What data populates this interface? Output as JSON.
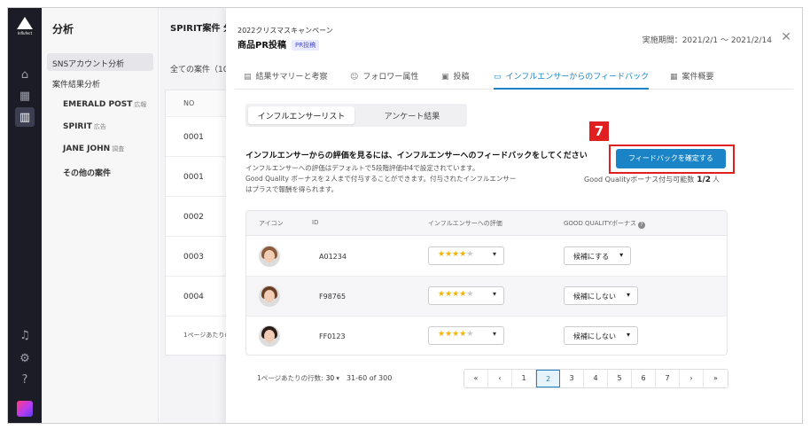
{
  "rail": {
    "logo_text": "Influfect",
    "icons": [
      "home-icon",
      "calendar-icon",
      "chart-icon",
      "bell-icon",
      "gear-icon",
      "help-icon"
    ]
  },
  "sidebar": {
    "title": "分析",
    "items": [
      {
        "label": "SNSアカウント分析",
        "tag": ""
      },
      {
        "label": "案件結果分析",
        "tag": ""
      },
      {
        "label": "EMERALD POST",
        "tag": "広報"
      },
      {
        "label": "SPIRIT",
        "tag": "広告"
      },
      {
        "label": "JANE JOHN",
        "tag": "調査"
      },
      {
        "label": "その他の案件",
        "tag": ""
      }
    ]
  },
  "bg": {
    "title": "SPIRIT案件 分析",
    "all_cases": "全ての案件（10",
    "col_no": "NO",
    "rows": [
      "0001",
      "0001",
      "0002",
      "0003",
      "0004"
    ],
    "footer": "1ページあたりの"
  },
  "modal": {
    "campaign": "2022クリスマスキャンペーン",
    "title": "商品PR投稿",
    "badge": "PR投稿",
    "period": "実施期間：2021/2/1 〜 2021/2/14",
    "close": "✕",
    "tabs": [
      {
        "icon": "▤",
        "label": "結果サマリーと考察"
      },
      {
        "icon": "☺",
        "label": "フォロワー属性"
      },
      {
        "icon": "▣",
        "label": "投稿"
      },
      {
        "icon": "▭",
        "label": "インフルエンサーからのフィードバック"
      },
      {
        "icon": "▦",
        "label": "案件概要"
      }
    ],
    "segment": [
      "インフルエンサーリスト",
      "アンケート結果"
    ],
    "heading": "インフルエンサーからの評価を見るには、インフルエンサーへのフィードバックをしてください",
    "desc_lines": [
      "インフルエンサーへの評価はデフォルトで5段階評価中4で設定されています。",
      "Good Quality ボーナスを２人まで付与することができます。付与されたインフルエンサー",
      "はプラスで報酬を得られます。"
    ],
    "step": "7",
    "cta": "フィードバックを確定する",
    "quota_label": "Good Qualityボーナス付与可能数",
    "quota_value": "1/2",
    "quota_unit": "人",
    "table": {
      "headers": [
        "アイコン",
        "ID",
        "インフルエンサーへの評価",
        "GOOD QUALITYボーナス"
      ],
      "help": "?",
      "rows": [
        {
          "id": "A01234",
          "rating": 4,
          "bonus": "候補にする"
        },
        {
          "id": "F98765",
          "rating": 4,
          "bonus": "候補にしない"
        },
        {
          "id": "FF0123",
          "rating": 4,
          "bonus": "候補にしない"
        }
      ]
    },
    "pagination": {
      "rows_label": "1ページあたりの行数:",
      "rows_value": "30",
      "range": "31-60 of 300",
      "buttons": [
        "«",
        "‹",
        "1",
        "2",
        "3",
        "4",
        "5",
        "6",
        "7",
        "›",
        "»"
      ],
      "current": "2"
    }
  }
}
